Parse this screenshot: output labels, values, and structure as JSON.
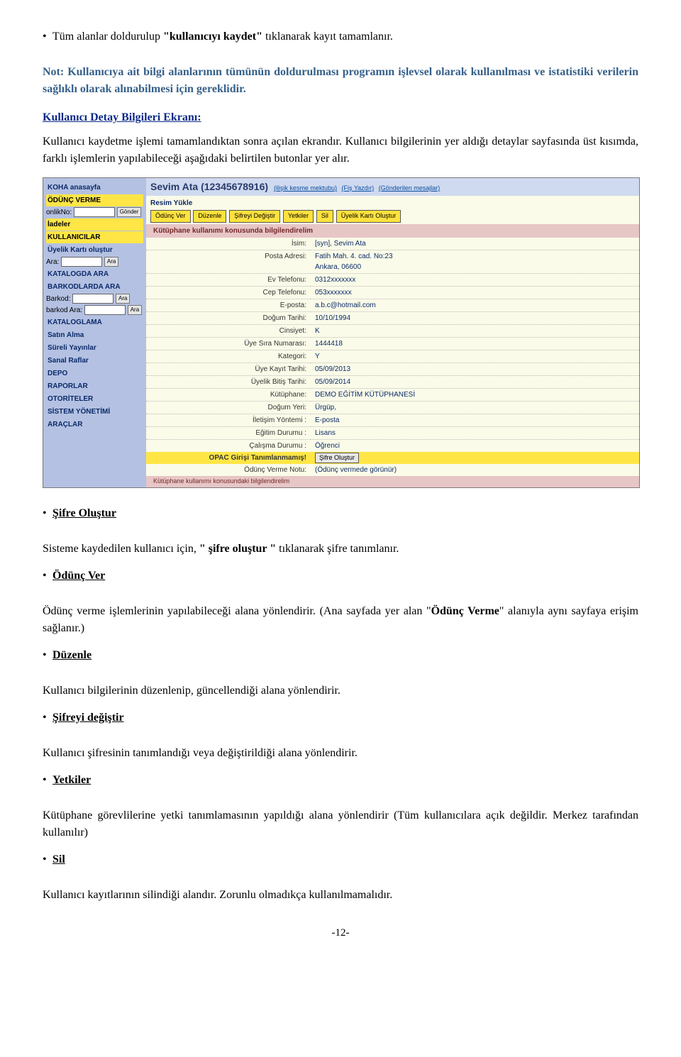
{
  "para1_prefix": "Tüm alanlar doldurulup ",
  "para1_bold": "\"kullanıcıyı kaydet\" ",
  "para1_suffix": "tıklanarak kayıt tamamlanır.",
  "note": "Not: Kullanıcıya ait bilgi alanlarının tümünün doldurulması programın işlevsel olarak kullanılması ve istatistiki verilerin sağlıklı olarak alınabilmesi için gereklidir.",
  "section_link": "Kullanıcı Detay Bilgileri Ekranı:",
  "para2": "Kullanıcı kaydetme işlemi tamamlandıktan sonra açılan ekrandır. Kullanıcı bilgilerinin yer aldığı detaylar sayfasında üst kısımda, farklı işlemlerin yapılabileceği aşağıdaki   belirtilen butonlar yer alır.",
  "shot": {
    "side": {
      "koha": "KOHA anasayfa",
      "odunc": "ÖDÜNÇ VERME",
      "onlikno": "onlikNo:",
      "gonder": "Gönder",
      "iadeler": "İadeler",
      "kullanicilar": "KULLANICILAR",
      "uyelik": "Üyelik Kartı oluştur",
      "ara_lbl": "Ara:",
      "ara_btn": "Ara",
      "katalogda": "KATALOGDA ARA",
      "barkodlarda": "BARKODLARDA ARA",
      "barkod_lbl": "Barkod:",
      "barkodara": "barkod Ara:",
      "kataloglama": "KATALOGLAMA",
      "satin": "Satın Alma",
      "sureli": "Süreli Yayınlar",
      "sanal": "Sanal Raflar",
      "depo": "DEPO",
      "rapor": "RAPORLAR",
      "otorite": "OTORİTELER",
      "sistem": "SİSTEM YÖNETİMİ",
      "araclar": "ARAÇLAR"
    },
    "header": {
      "name": "Sevim Ata (12345678916)",
      "links": [
        "(ilişik kesme mektubu)",
        "(Fiş Yazdır)",
        "(Gönderilen mesajlar)"
      ]
    },
    "resim": "Resim Yükle",
    "buttons": [
      "Ödünç Ver",
      "Düzenle",
      "Şifreyi Değiştir",
      "Yetkiler",
      "Sil",
      "Üyelik Kartı Oluştur"
    ],
    "notice": "Kütüphane kullanımı konusunda bilgilendirelim",
    "rows": [
      {
        "l": "İsim:",
        "v": "[syn], Sevim Ata"
      },
      {
        "l": "Posta Adresi:",
        "v": "Fatih Mah. 4. cad. No:23\nAnkara, 06600"
      },
      {
        "l": "Ev Telefonu:",
        "v": "0312xxxxxxx"
      },
      {
        "l": "Cep Telefonu:",
        "v": "053xxxxxxx"
      },
      {
        "l": "E-posta:",
        "v": "a.b.c@hotmail.com"
      },
      {
        "l": "Doğum Tarihi:",
        "v": "10/10/1994"
      },
      {
        "l": "Cinsiyet:",
        "v": "K"
      },
      {
        "l": "Üye Sıra Numarası:",
        "v": "1444418"
      },
      {
        "l": "Kategori:",
        "v": "Y"
      },
      {
        "l": "Üye Kayıt Tarihi:",
        "v": "05/09/2013"
      },
      {
        "l": "Üyelik Bitiş Tarihi:",
        "v": "05/09/2014"
      },
      {
        "l": "Kütüphane:",
        "v": "DEMO EĞİTİM KÜTÜPHANESİ"
      },
      {
        "l": "Doğum Yeri:",
        "v": "Ürgüp,"
      },
      {
        "l": "İletişim Yöntemi :",
        "v": "E-posta"
      },
      {
        "l": "Eğitim Durumu :",
        "v": "Lisans"
      },
      {
        "l": "Çalışma Durumu :",
        "v": "Öğrenci"
      }
    ],
    "opac_label": "OPAC Girişi Tanımlanmamış!",
    "opac_btn": "Şifre Oluştur",
    "odunc_notu_l": "Ödünç Verme Notu:",
    "odunc_notu_v": "(Ödünç vermede görünür)",
    "foot_notice": "Kütüphane kullanımı konusundaki bilgilendirelim"
  },
  "h_sifre": "Şifre Oluştur",
  "p_sifre_a": "Sisteme kaydedilen kullanıcı için, ",
  "p_sifre_b": "\" şifre oluştur \" ",
  "p_sifre_c": "tıklanarak şifre tanımlanır.",
  "h_odunc": "Ödünç Ver",
  "p_odunc_a": " Ödünç verme işlemlerinin yapılabileceği  alana yönlendirir. (Ana sayfada yer alan \"",
  "p_odunc_b": "Ödünç Verme",
  "p_odunc_c": "\" alanıyla aynı sayfaya erişim sağlanır.)",
  "h_duzenle": "Düzenle",
  "p_duzenle": "Kullanıcı bilgilerinin düzenlenip, güncellendiği alana yönlendirir.",
  "h_sifreyi": "Şifreyi değiştir",
  "p_sifreyi": "Kullanıcı şifresinin tanımlandığı veya değiştirildiği alana yönlendirir.",
  "h_yetkiler": "Yetkiler",
  "p_yetkiler": "Kütüphane görevlilerine yetki tanımlamasının yapıldığı alana yönlendirir (Tüm kullanıcılara açık değildir. Merkez tarafından kullanılır)",
  "h_sil": "Sil",
  "p_sil": "Kullanıcı kayıtlarının silindiği alandır. Zorunlu olmadıkça kullanılmamalıdır.",
  "pagenum": "-12-"
}
